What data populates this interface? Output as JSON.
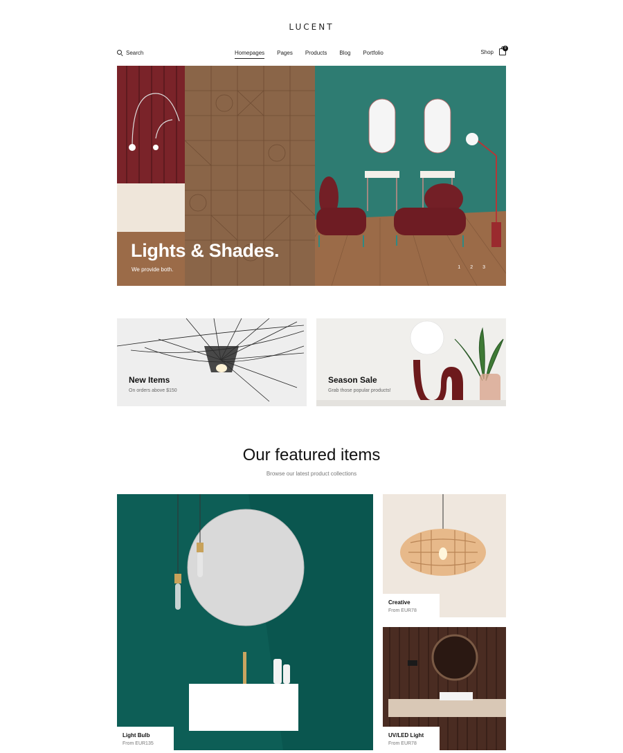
{
  "header": {
    "logo": "LUCENT"
  },
  "nav": {
    "search_label": "Search",
    "items": [
      "Homepages",
      "Pages",
      "Products",
      "Blog",
      "Portfolio"
    ],
    "active_item": "Homepages",
    "shop_label": "Shop",
    "cart_count": "0"
  },
  "hero": {
    "title": "Lights & Shades.",
    "subtitle": "We provide both.",
    "slides": [
      "1",
      "2",
      "3"
    ]
  },
  "promos": [
    {
      "title": "New Items",
      "subtitle": "On orders above $150"
    },
    {
      "title": "Season Sale",
      "subtitle": "Grab those popular products!"
    }
  ],
  "featured": {
    "title": "Our featured items",
    "subtitle": "Browse our latest product collections",
    "products": [
      {
        "name": "Light Bulb",
        "price": "From EUR135"
      },
      {
        "name": "Creative",
        "price": "From EUR78"
      },
      {
        "name": "UV/LED Light",
        "price": "From EUR78"
      }
    ]
  },
  "colors": {
    "hero_teal": "#2e7c72",
    "burgundy": "#6e1f26",
    "wood": "#8a6548",
    "deep_teal": "#0d5e56"
  }
}
